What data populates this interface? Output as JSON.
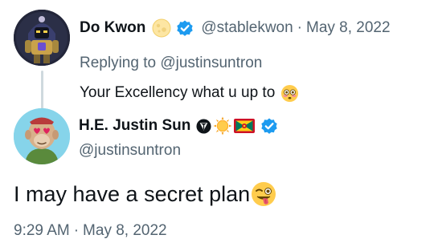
{
  "parent_tweet": {
    "avatar": "robot-avatar",
    "display_name": "Do Kwon",
    "name_emoji": "full-moon-icon",
    "verified_icon": "verified-badge-icon",
    "handle": "@stablekwon",
    "separator": "·",
    "date": "May 8, 2022",
    "replying_prefix": "Replying to ",
    "replying_to": "@justinsuntron",
    "text": "Your Excellency what u up to",
    "text_emoji": "flushed-face-icon"
  },
  "main_tweet": {
    "avatar": "ape-avatar",
    "display_name": "H.E. Justin Sun",
    "name_badges": [
      "tron-logo-icon",
      "sun-icon",
      "grenada-flag-icon"
    ],
    "verified_icon": "verified-badge-icon",
    "handle": "@justinsuntron",
    "text": "I may have a secret plan",
    "text_emoji": "winking-tongue-face-icon",
    "time": "9:29 AM",
    "separator": "·",
    "date": "May 8, 2022"
  },
  "colors": {
    "primary_text": "#0f1419",
    "secondary_text": "#536471",
    "verified_blue": "#1d9bf0",
    "thread_line": "#cfd9de",
    "background": "#ffffff"
  }
}
